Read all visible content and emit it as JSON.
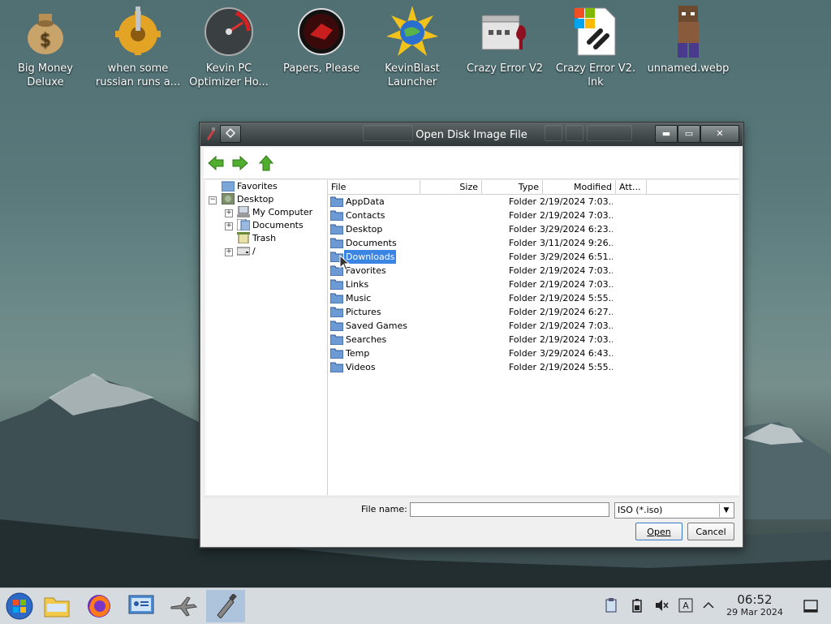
{
  "desktop": {
    "icons": [
      {
        "label": "Big Money\nDeluxe",
        "icon": "money-bag-icon"
      },
      {
        "label": "when some\nrussian runs a...",
        "icon": "gear-icon"
      },
      {
        "label": "Kevin PC\nOptimizer Ho...",
        "icon": "speedometer-icon"
      },
      {
        "label": "Papers, Please",
        "icon": "red-stamp-icon"
      },
      {
        "label": "KevinBlast\nLauncher",
        "icon": "sun-globe-icon"
      },
      {
        "label": "Crazy Error V2",
        "icon": "wine-app-icon"
      },
      {
        "label": "Crazy Error V2.\nlnk",
        "icon": "link-file-icon"
      },
      {
        "label": "unnamed.webp",
        "icon": "pixel-character-icon"
      }
    ]
  },
  "dialog": {
    "title": "Open Disk Image File",
    "window_buttons": {
      "minimize": "▬",
      "maximize": "▭",
      "close": "✕"
    },
    "tree": [
      {
        "label": "Favorites",
        "icon": "star-folder-icon",
        "level": 0
      },
      {
        "label": "Desktop",
        "icon": "desktop-icon",
        "level": 0,
        "expander": "−"
      },
      {
        "label": "My Computer",
        "icon": "computer-icon",
        "level": 1,
        "expander": "+"
      },
      {
        "label": "Documents",
        "icon": "documents-icon",
        "level": 1,
        "expander": "+"
      },
      {
        "label": "Trash",
        "icon": "trash-icon",
        "level": 1
      },
      {
        "label": "/",
        "icon": "drive-icon",
        "level": 1,
        "expander": "+"
      }
    ],
    "columns": {
      "file": "File",
      "size": "Size",
      "type": "Type",
      "modified": "Modified",
      "attributes": "Att..."
    },
    "files": [
      {
        "name": "AppData",
        "type": "Folder",
        "modified": "2/19/2024 7:03..."
      },
      {
        "name": "Contacts",
        "type": "Folder",
        "modified": "2/19/2024 7:03..."
      },
      {
        "name": "Desktop",
        "type": "Folder",
        "modified": "3/29/2024 6:23..."
      },
      {
        "name": "Documents",
        "type": "Folder",
        "modified": "3/11/2024 9:26..."
      },
      {
        "name": "Downloads",
        "type": "Folder",
        "modified": "3/29/2024 6:51...",
        "selected": true
      },
      {
        "name": "Favorites",
        "type": "Folder",
        "modified": "2/19/2024 7:03..."
      },
      {
        "name": "Links",
        "type": "Folder",
        "modified": "2/19/2024 7:03..."
      },
      {
        "name": "Music",
        "type": "Folder",
        "modified": "2/19/2024 5:55..."
      },
      {
        "name": "Pictures",
        "type": "Folder",
        "modified": "2/19/2024 6:27..."
      },
      {
        "name": "Saved Games",
        "type": "Folder",
        "modified": "2/19/2024 7:03..."
      },
      {
        "name": "Searches",
        "type": "Folder",
        "modified": "2/19/2024 7:03..."
      },
      {
        "name": "Temp",
        "type": "Folder",
        "modified": "3/29/2024 6:43..."
      },
      {
        "name": "Videos",
        "type": "Folder",
        "modified": "2/19/2024 5:55..."
      }
    ],
    "file_name_label": "File name:",
    "file_name_value": "",
    "filter": "ISO (*.iso)",
    "open_label": "Open",
    "cancel_label": "Cancel"
  },
  "taskbar": {
    "time": "06:52",
    "date": "29 Mar 2024"
  },
  "colors": {
    "selection": "#3a84e3",
    "taskbar": "#d6dbe0"
  }
}
